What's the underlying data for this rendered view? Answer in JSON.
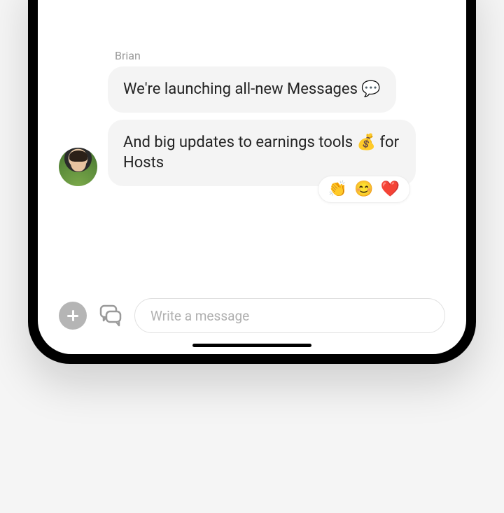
{
  "sender": "Brian",
  "messages": [
    {
      "text": "We're launching all-new Messages 💬"
    },
    {
      "text": "And big updates to earnings tools 💰 for Hosts"
    }
  ],
  "reactions": [
    "👏",
    "😊",
    "❤️"
  ],
  "composer": {
    "placeholder": "Write a message"
  }
}
